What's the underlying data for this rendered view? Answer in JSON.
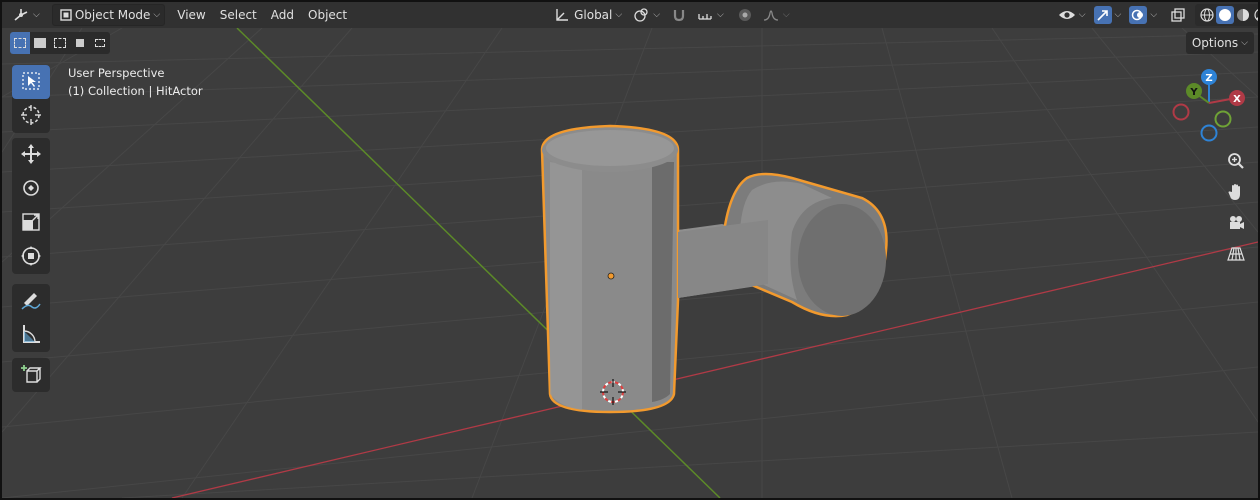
{
  "header": {
    "editor_icon": "editor-type-icon",
    "mode": "Object Mode",
    "menus": [
      "View",
      "Select",
      "Add",
      "Object"
    ],
    "orientation": "Global"
  },
  "options_label": "Options",
  "viewport": {
    "perspective": "User Perspective",
    "collection": "(1) Collection | HitActor"
  },
  "gizmo": {
    "z": "Z",
    "y": "Y",
    "x": "X"
  },
  "colors": {
    "accent": "#4772b3",
    "selection_outline": "#f29a2e",
    "x_axis": "#b03a46",
    "y_axis": "#5c8a28",
    "z_axis": "#2e83d6",
    "grid_bg": "#3d3d3d"
  }
}
